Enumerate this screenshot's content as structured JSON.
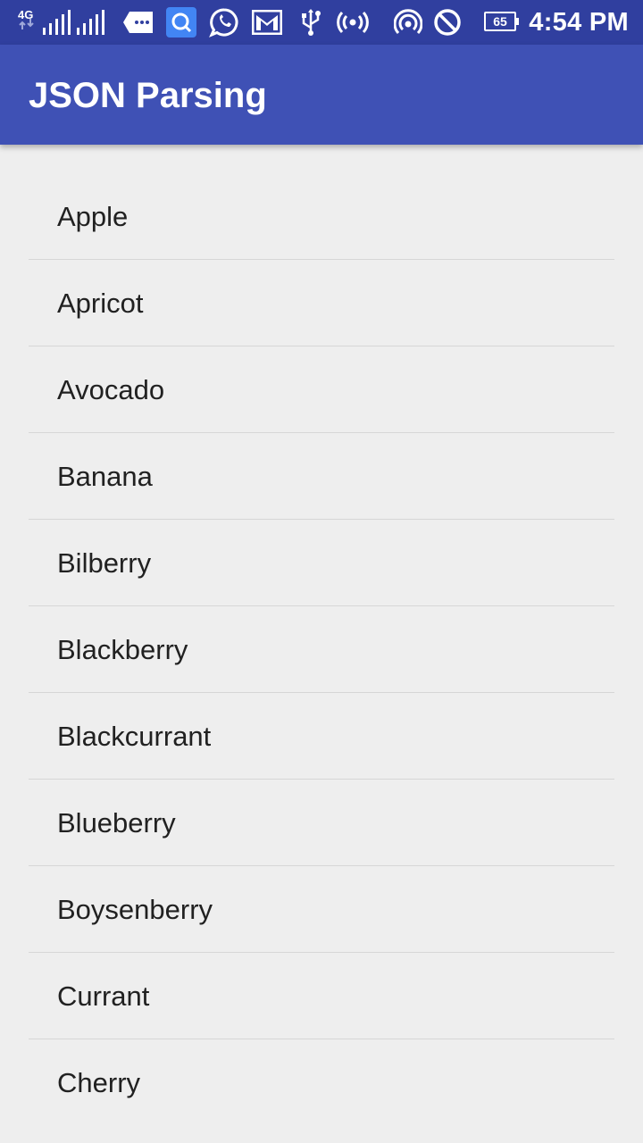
{
  "status_bar": {
    "network_type": "4G",
    "battery_level": "65",
    "time": "4:54 PM",
    "icons": [
      "signal-icon",
      "signal-icon",
      "messages-icon",
      "search-app-icon",
      "whatsapp-icon",
      "gmail-icon",
      "usb-icon",
      "hotspot-icon",
      "cast-icon",
      "do-not-disturb-icon",
      "battery-icon"
    ]
  },
  "app_bar": {
    "title": "JSON Parsing"
  },
  "list": {
    "items": [
      {
        "label": "Apple"
      },
      {
        "label": "Apricot"
      },
      {
        "label": "Avocado"
      },
      {
        "label": "Banana"
      },
      {
        "label": "Bilberry"
      },
      {
        "label": "Blackberry"
      },
      {
        "label": "Blackcurrant"
      },
      {
        "label": "Blueberry"
      },
      {
        "label": "Boysenberry"
      },
      {
        "label": "Currant"
      },
      {
        "label": "Cherry"
      }
    ]
  },
  "colors": {
    "status_bar": "#303f9f",
    "app_bar": "#3f51b5",
    "background": "#eeeeee",
    "text": "#212121",
    "divider": "#d6d6d6"
  }
}
